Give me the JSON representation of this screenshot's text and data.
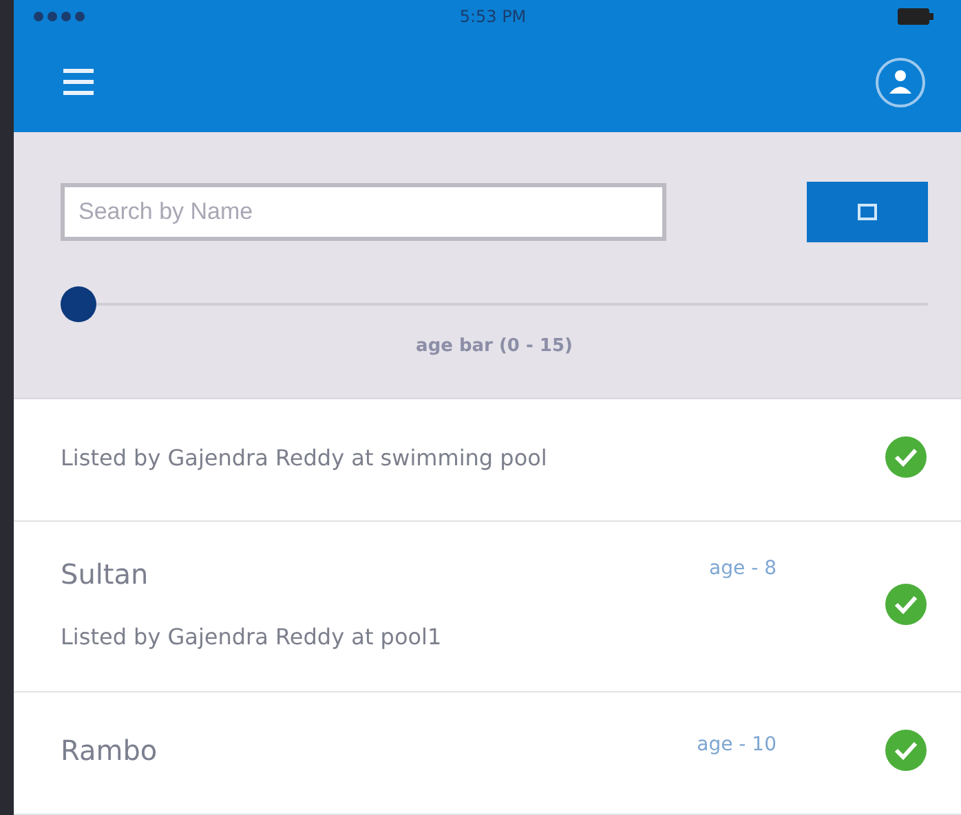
{
  "status_bar": {
    "time": "5:53 PM"
  },
  "filter": {
    "search": {
      "placeholder": "Search by Name"
    },
    "age_slider": {
      "level": 0,
      "label": "age bar (0 - 15)"
    }
  },
  "list": [
    {
      "description": "Listed by Gajendra Reddy at swimming pool",
      "checked": true
    },
    {
      "name": "Sultan",
      "age": "age - 8",
      "description": "Listed by Gajendra Reddy at pool1",
      "checked": true
    },
    {
      "name": "Rambo",
      "age": "age - 10",
      "checked": true
    }
  ]
}
